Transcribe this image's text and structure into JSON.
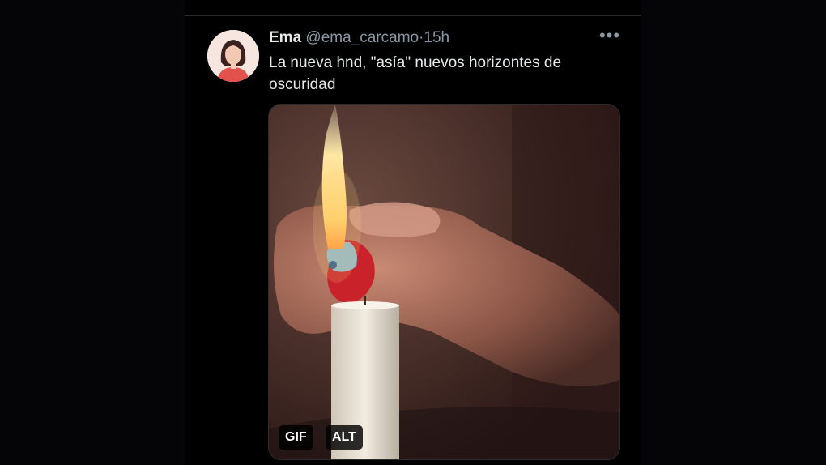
{
  "tweet": {
    "author_name": "Ema",
    "handle": "@ema_carcamo",
    "separator": "·",
    "time": "15h",
    "more_icon": "more-horizontal-icon",
    "text": "La nueva hnd, \"asía\" nuevos horizontes de oscuridad"
  },
  "media": {
    "gif_label": "GIF",
    "alt_label": "ALT"
  },
  "colors": {
    "background": "#000000",
    "text_primary": "#e7e9ea",
    "text_secondary": "#8b98a5",
    "border": "#2a2d31"
  }
}
